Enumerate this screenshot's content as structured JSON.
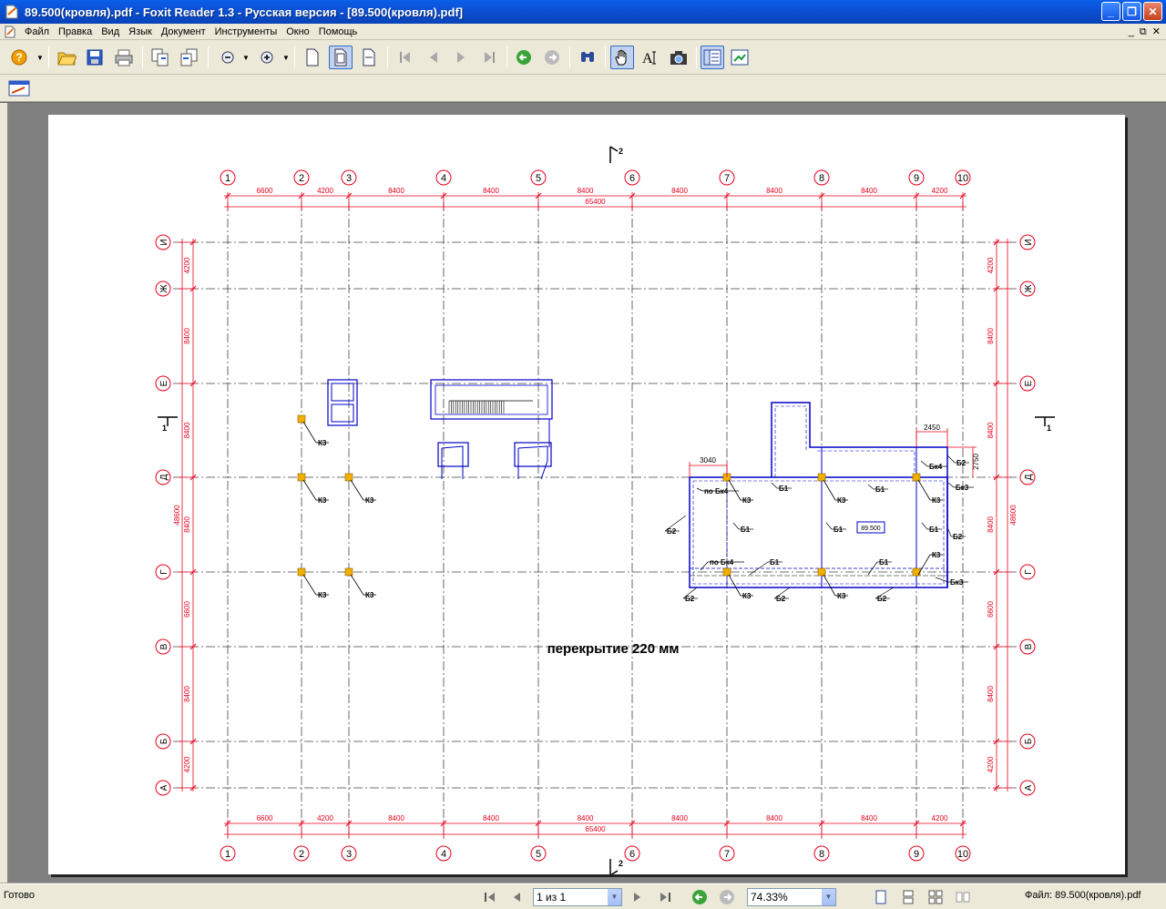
{
  "window": {
    "title": "89.500(кровля).pdf - Foxit Reader 1.3 - Русская версия  - [89.500(кровля).pdf]",
    "min_label": "_",
    "max_label": "❐",
    "close_label": "✕"
  },
  "menu": {
    "items": [
      "Файл",
      "Правка",
      "Вид",
      "Язык",
      "Документ",
      "Инструменты",
      "Окно",
      "Помощь"
    ],
    "mdi_min": "_",
    "mdi_restore": "⧉",
    "mdi_close": "✕"
  },
  "toolbar": {
    "icons": [
      "help-icon",
      "open-folder-icon",
      "save-icon",
      "print-icon",
      "copy-page-icon",
      "paste-page-icon",
      "zoom-out-icon",
      "zoom-in-icon",
      "single-page-icon",
      "fit-page-icon",
      "fit-width-icon",
      "first-page-icon",
      "prev-page-icon",
      "next-page-icon",
      "last-page-icon",
      "back-icon",
      "forward-icon",
      "find-icon",
      "hand-tool-icon",
      "text-select-icon",
      "snapshot-icon",
      "bookmarks-panel-icon",
      "thumbnails-icon"
    ],
    "row2_icons": [
      "annotation-tool-icon"
    ]
  },
  "drawing": {
    "section_mark": "2",
    "section_mark_side": "1",
    "axes_x": [
      "1",
      "2",
      "3",
      "4",
      "5",
      "6",
      "7",
      "8",
      "9",
      "10"
    ],
    "spans_x": [
      "6600",
      "4200",
      "8400",
      "8400",
      "8400",
      "8400",
      "8400",
      "8400",
      "4200"
    ],
    "total_x": "65400",
    "axes_y": [
      "И",
      "Ж",
      "Е",
      "Д",
      "Г",
      "В",
      "Б",
      "А"
    ],
    "spans_y": [
      "4200",
      "8400",
      "8400",
      "8400",
      "6600",
      "8400",
      "4200"
    ],
    "total_y": "48600",
    "k3": "К3",
    "b1": "Б1",
    "b2": "Б2",
    "bk3": "Бк3",
    "bk4": "Бк4",
    "po_bk4": "по Бк4",
    "dim_3040": "3040",
    "dim_2450": "2450",
    "dim_2750": "2750",
    "elevation": "89.500",
    "slab_label": "перекрытие 220 мм",
    "colors": {
      "axis": "#e8001c",
      "structure": "#0000c8",
      "column": "#f0b000",
      "text": "#000000"
    }
  },
  "status": {
    "ready": "Готово",
    "page_value": "1 из 1",
    "zoom_value": "74.33%",
    "file_label": "Файл: 89.500(кровля).pdf"
  }
}
